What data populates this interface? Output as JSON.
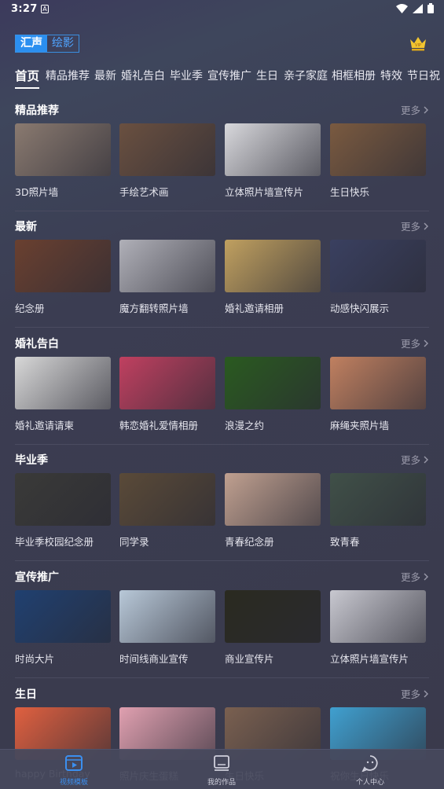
{
  "status": {
    "time": "3:27",
    "notif_icon": "A"
  },
  "app": {
    "logo_a": "汇声",
    "logo_b": "绘影",
    "vip_icon": "crown-icon"
  },
  "tabs": [
    "首页",
    "精品推荐",
    "最新",
    "婚礼告白",
    "毕业季",
    "宣传推广",
    "生日",
    "亲子家庭",
    "相框相册",
    "特效",
    "节日祝"
  ],
  "more_label": "更多",
  "sections": [
    {
      "title": "精品推荐",
      "items": [
        "3D照片墙",
        "手绘艺术画",
        "立体照片墙宣传片",
        "生日快乐"
      ]
    },
    {
      "title": "最新",
      "items": [
        "纪念册",
        "魔方翻转照片墙",
        "婚礼邀请相册",
        "动感快闪展示"
      ]
    },
    {
      "title": "婚礼告白",
      "items": [
        "婚礼邀请请柬",
        "韩恋婚礼爱情相册",
        "浪漫之约",
        "麻绳夹照片墙"
      ]
    },
    {
      "title": "毕业季",
      "items": [
        "毕业季校园纪念册",
        "同学录",
        "青春纪念册",
        "致青春"
      ]
    },
    {
      "title": "宣传推广",
      "items": [
        "时尚大片",
        "时间线商业宣传",
        "商业宣传片",
        "立体照片墙宣传片"
      ]
    },
    {
      "title": "生日",
      "items": [
        "happy Birthday",
        "照片庆生蛋糕",
        "生日快乐",
        "祝你生日快乐"
      ]
    }
  ],
  "bottom_nav": [
    {
      "label": "视频模板",
      "icon": "video-template-icon"
    },
    {
      "label": "我的作品",
      "icon": "my-works-icon"
    },
    {
      "label": "个人中心",
      "icon": "profile-icon"
    }
  ],
  "thumb_colors": [
    [
      "#8a7a70",
      "#6a5040",
      "#d8d8dc",
      "#7a5a40"
    ],
    [
      "#6a4030",
      "#b0b0b8",
      "#c0a060",
      "#3a4060"
    ],
    [
      "#d8d8d8",
      "#c04060",
      "#2a5a20",
      "#c08060"
    ],
    [
      "#3a3a38",
      "#5a4a38",
      "#c0a090",
      "#405048"
    ],
    [
      "#204070",
      "#b8c8d8",
      "#2a2a20",
      "#c8c8d0"
    ],
    [
      "#e06040",
      "#e0a0b0",
      "#7a6050",
      "#40a0d0"
    ]
  ]
}
